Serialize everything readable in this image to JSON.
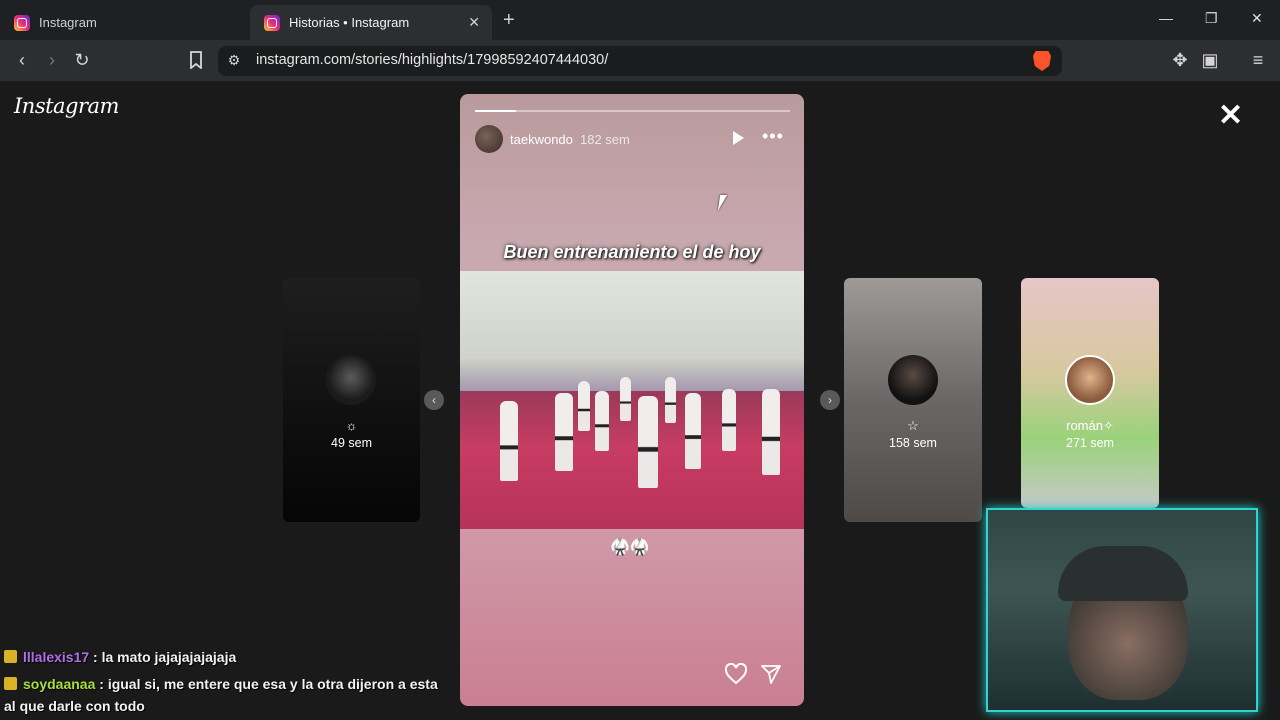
{
  "browser": {
    "tabs": [
      {
        "title": "Instagram",
        "active": false
      },
      {
        "title": "Historias • Instagram",
        "active": true
      }
    ],
    "url": "instagram.com/stories/highlights/17998592407444030/"
  },
  "page": {
    "logo": "Instagram",
    "story": {
      "username": "taekwondo",
      "time": "182 sem",
      "caption": "Buen entrenamiento el de hoy",
      "emoji": "🥋🥋",
      "progress": 0.13
    },
    "side_stories": [
      {
        "title": "☼",
        "sub": "49 sem"
      },
      {
        "title": "☆",
        "sub": "158 sem"
      },
      {
        "title": "román✧",
        "sub": "271 sem"
      }
    ]
  },
  "chat": [
    {
      "user": "lllalexis17",
      "message": " : la mato jajajajajajaja"
    },
    {
      "user": "soydaanaa",
      "message": " : igual si, me entere que esa y la otra dijeron a esta",
      "continuation": "al que darle con todo"
    }
  ],
  "colors": {
    "brave": "#fb542b",
    "webcam_border": "#2fd3d0",
    "chat_user1": "#b06ee8",
    "chat_user2": "#a6e03a"
  }
}
